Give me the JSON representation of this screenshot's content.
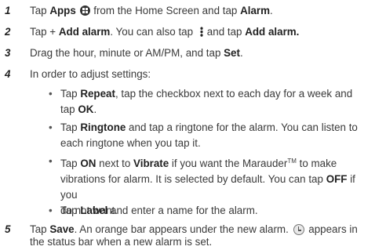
{
  "steps": [
    {
      "number": "1",
      "parts": [
        "Tap ",
        "Apps",
        " from the Home Screen and tap ",
        "Alarm",
        "."
      ],
      "icon": "apps-grid-icon"
    },
    {
      "number": "2",
      "parts": [
        "Tap + ",
        "Add alarm",
        ". You can also tap ",
        "and tap ",
        "Add alarm."
      ],
      "icon": "menu-dots-icon"
    },
    {
      "number": "3",
      "parts": [
        "Drag the hour, minute or AM/PM, and tap ",
        "Set",
        "."
      ]
    },
    {
      "number": "4",
      "text": "In order to adjust settings:"
    },
    {
      "number": "5",
      "parts": [
        "Tap ",
        "Save",
        ". An orange bar appears under the new alarm. ",
        "appears in",
        "the status bar when a new alarm is set."
      ],
      "icon": "alarm-clock-icon"
    }
  ],
  "bullets": [
    {
      "parts": [
        "Tap ",
        "Repeat",
        ", tap the checkbox next to each day for a week and",
        "tap ",
        "OK",
        "."
      ]
    },
    {
      "parts": [
        "Tap ",
        "Ringtone",
        " and tap a ringtone for the alarm. You can listen to",
        "each ringtone when you tap it."
      ]
    },
    {
      "parts": [
        "Tap ",
        "ON",
        " next to ",
        "Vibrate",
        " if you want the Marauder",
        "TM",
        " to make",
        "vibrations for alarm. It is selected by default. You can tap ",
        "OFF",
        " if you",
        "do not want."
      ]
    },
    {
      "parts": [
        "Tap ",
        "Label",
        " and enter a name for the alarm."
      ]
    }
  ],
  "bullet_symbol": "•"
}
